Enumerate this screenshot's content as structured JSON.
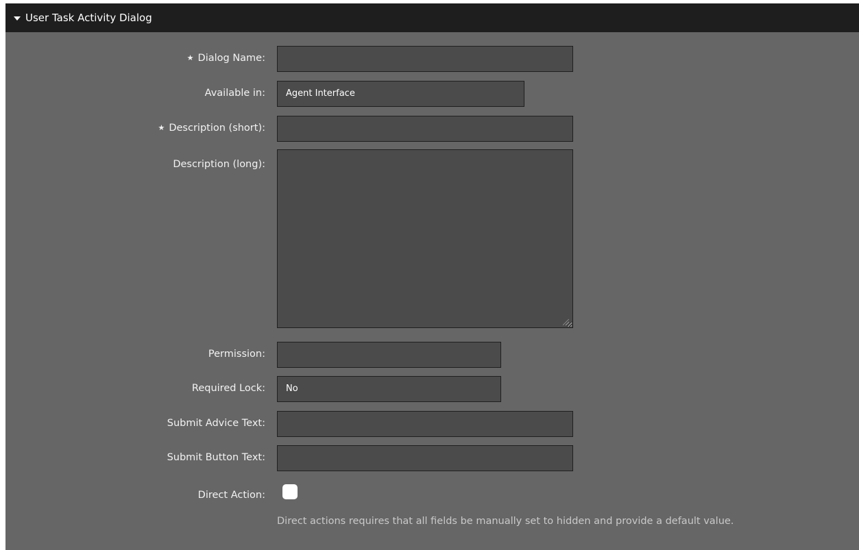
{
  "header": {
    "title": "User Task Activity Dialog"
  },
  "form": {
    "dialog_name": {
      "label": "Dialog Name:",
      "required": true,
      "value": ""
    },
    "available_in": {
      "label": "Available in:",
      "value": "Agent Interface"
    },
    "description_short": {
      "label": "Description (short):",
      "required": true,
      "value": ""
    },
    "description_long": {
      "label": "Description (long):",
      "value": ""
    },
    "permission": {
      "label": "Permission:",
      "value": ""
    },
    "required_lock": {
      "label": "Required Lock:",
      "value": "No"
    },
    "submit_advice_text": {
      "label": "Submit Advice Text:",
      "value": ""
    },
    "submit_button_text": {
      "label": "Submit Button Text:",
      "value": ""
    },
    "direct_action": {
      "label": "Direct Action:",
      "checked": false,
      "hint": "Direct actions requires that all fields be manually set to hidden and provide a default value."
    }
  },
  "icons": {
    "required": "★",
    "collapse": "triangle-down"
  },
  "colors": {
    "panel_bg": "#666666",
    "header_bg": "#1e1e1e",
    "field_bg": "#4b4b4b",
    "field_border": "#1f1f1f",
    "text": "#f2f2f2",
    "hint_text": "#c9c9c9"
  }
}
